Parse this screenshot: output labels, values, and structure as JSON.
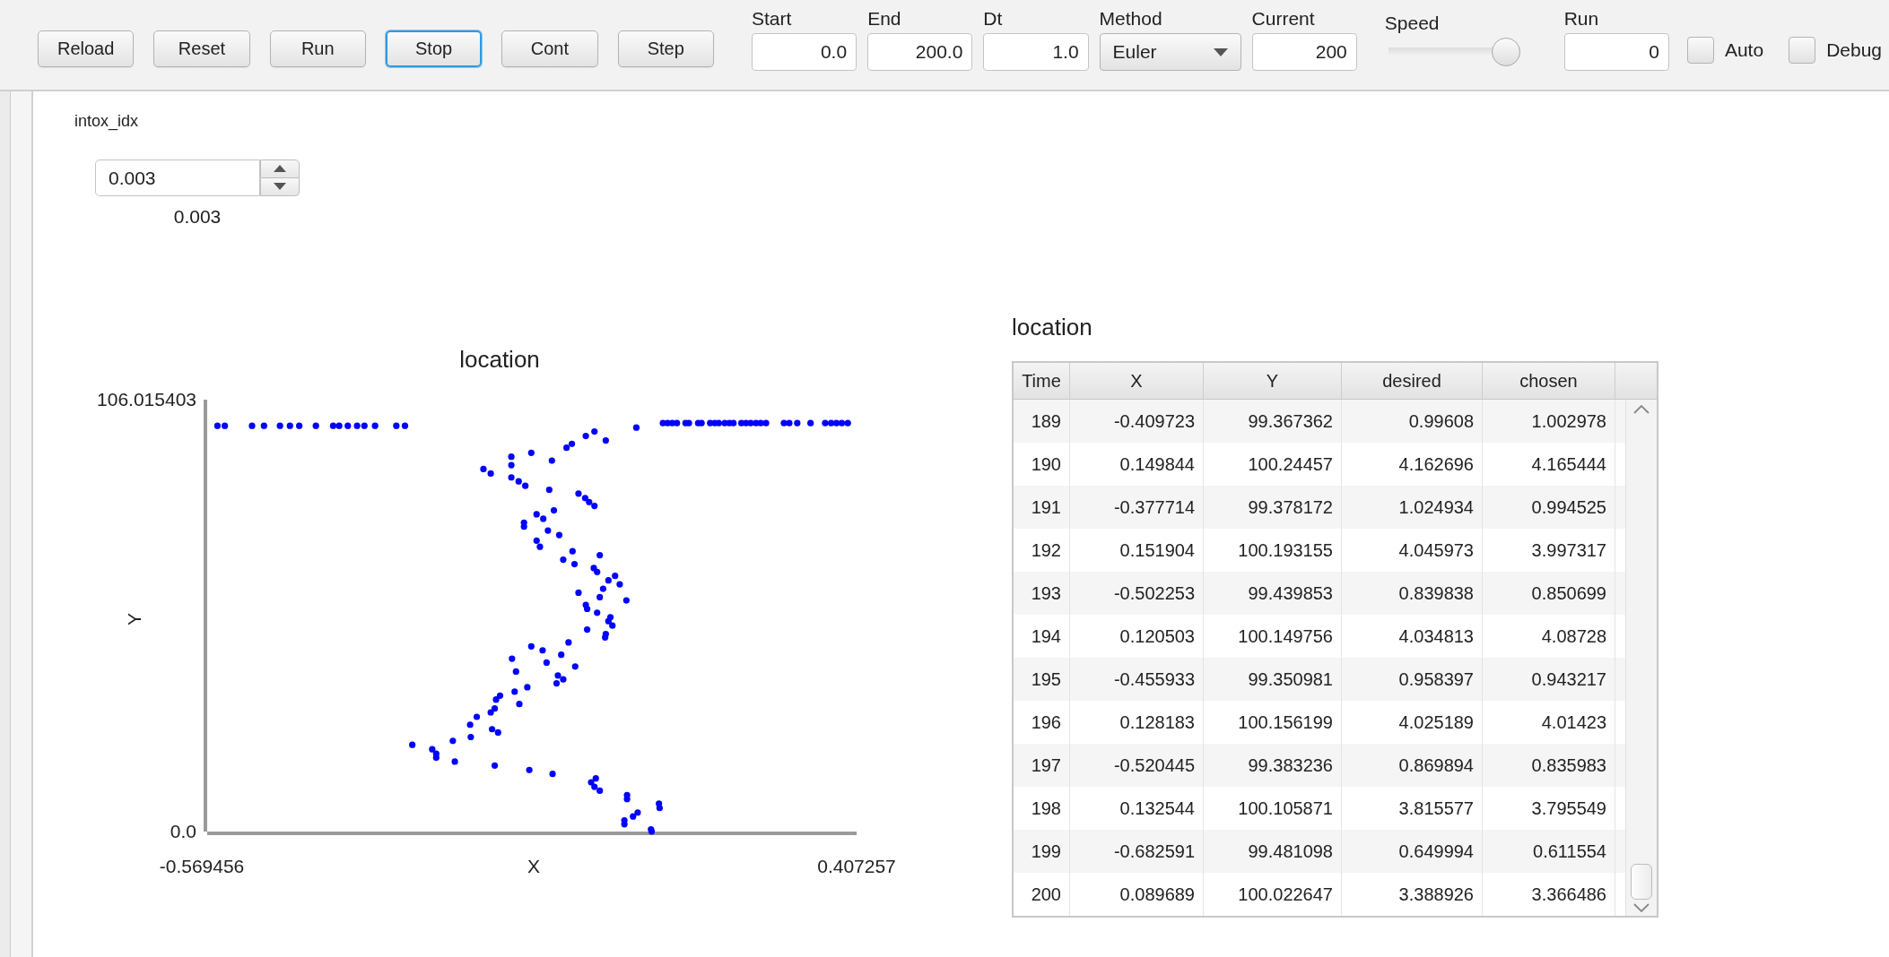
{
  "toolbar": {
    "buttons": [
      {
        "label": "Reload",
        "focused": false
      },
      {
        "label": "Reset",
        "focused": false
      },
      {
        "label": "Run",
        "focused": false
      },
      {
        "label": "Stop",
        "focused": true
      },
      {
        "label": "Cont",
        "focused": false
      },
      {
        "label": "Step",
        "focused": false
      }
    ],
    "fields": [
      {
        "kind": "text",
        "label": "Start",
        "value": "0.0"
      },
      {
        "kind": "text",
        "label": "End",
        "value": "200.0"
      },
      {
        "kind": "text",
        "label": "Dt",
        "value": "1.0"
      },
      {
        "kind": "dropdown",
        "label": "Method",
        "value": "Euler"
      },
      {
        "kind": "text",
        "label": "Current",
        "value": "200"
      },
      {
        "kind": "slider",
        "label": "Speed",
        "level": 1
      },
      {
        "kind": "text",
        "label": "Run",
        "value": "0"
      }
    ],
    "checkboxes": [
      {
        "label": "Auto",
        "checked": false
      },
      {
        "label": "Debug",
        "checked": false
      }
    ]
  },
  "parameter": {
    "label": "intox_idx",
    "value": "0.003",
    "reading": "0.003"
  },
  "chart": {
    "chart_data": {
      "type": "scatter",
      "title": "location",
      "xlabel": "X",
      "ylabel": "Y",
      "xlim": [
        -0.569456,
        0.407257
      ],
      "ylim": [
        0,
        106.015403
      ],
      "xticks": [
        {
          "value": -0.569456,
          "label": "-0.569456"
        },
        {
          "value": 0.407257,
          "label": "0.407257"
        }
      ],
      "yticks": [
        {
          "value": 0,
          "label": "0.0"
        },
        {
          "value": 106.015403,
          "label": "106.015403"
        }
      ],
      "x": [
        -0.554,
        -0.543,
        -0.502,
        -0.484,
        -0.46,
        -0.445,
        -0.431,
        -0.406,
        -0.38,
        -0.371,
        -0.358,
        -0.344,
        -0.333,
        -0.317,
        -0.285,
        -0.272,
        0.116,
        0.123,
        0.13,
        0.137,
        0.15,
        0.155,
        0.169,
        0.174,
        0.187,
        0.194,
        0.2,
        0.209,
        0.216,
        0.222,
        0.234,
        0.241,
        0.248,
        0.256,
        0.263,
        0.271,
        0.298,
        0.306,
        0.318,
        0.338,
        0.36,
        0.369,
        0.377,
        0.385,
        0.394,
        0.076,
        0.013,
        0,
        0.03,
        -0.021,
        -0.029,
        -0.082,
        -0.112,
        -0.051,
        -0.112,
        -0.154,
        -0.143,
        -0.112,
        -0.101,
        -0.091,
        -0.055,
        -0.011,
        -0.001,
        0.005,
        0.013,
        -0.048,
        -0.074,
        -0.064,
        -0.093,
        -0.093,
        -0.057,
        -0.04,
        -0.074,
        -0.069,
        -0.02,
        -0.034,
        -0.017,
        0.021,
        0.012,
        0.017,
        0.044,
        0.034,
        0.051,
        0.026,
        -0.011,
        0.021,
        0.061,
        0,
        0.002,
        0.017,
        0.037,
        0.034,
        0.04,
        0.002,
        0.03,
        0.029,
        -0.026,
        -0.082,
        -0.065,
        -0.037,
        -0.111,
        -0.059,
        -0.016,
        -0.105,
        -0.042,
        -0.034,
        -0.044,
        -0.088,
        -0.107,
        -0.129,
        -0.135,
        -0.1,
        -0.137,
        -0.143,
        -0.164,
        -0.174,
        -0.141,
        -0.132,
        -0.173,
        -0.2,
        -0.261,
        -0.231,
        -0.225,
        -0.225,
        -0.197,
        -0.137,
        -0.085,
        -0.05,
        0.015,
        0.008,
        0.013,
        0.021,
        0.062,
        0.062,
        0.11,
        0.111,
        0.078,
        0.071,
        0.058,
        0.058,
        0.098,
        0.099
      ],
      "series": [
        {
          "color": "#0000ff",
          "values": [
            99.6,
            99.6,
            99.6,
            99.6,
            99.6,
            99.6,
            99.6,
            99.6,
            99.6,
            99.6,
            99.6,
            99.6,
            99.6,
            99.6,
            99.6,
            99.6,
            100.25,
            100.25,
            100.25,
            100.25,
            100.25,
            100.25,
            100.25,
            100.25,
            100.25,
            100.25,
            100.25,
            100.25,
            100.25,
            100.25,
            100.25,
            100.25,
            100.25,
            100.25,
            100.25,
            100.25,
            100.25,
            100.25,
            100.25,
            100.25,
            100.25,
            100.25,
            100.25,
            100.25,
            100.25,
            99.15,
            98.19,
            97.09,
            95.99,
            95.17,
            94.21,
            92.97,
            92.01,
            91.05,
            89.95,
            88.99,
            87.89,
            86.93,
            85.97,
            84.87,
            83.91,
            82.95,
            81.85,
            80.89,
            79.93,
            78.83,
            77.87,
            76.77,
            75.81,
            74.84,
            73.88,
            72.78,
            71.41,
            69.9,
            68.8,
            66.74,
            65.64,
            67.84,
            64.68,
            63.72,
            62.76,
            61.66,
            60.7,
            59.6,
            58.64,
            57.54,
            56.72,
            55.62,
            54.66,
            53.7,
            52.6,
            51.64,
            50.54,
            49.58,
            48.48,
            47.65,
            46.42,
            45.46,
            44.49,
            43.4,
            42.43,
            41.47,
            40.51,
            39.28,
            38.31,
            37.35,
            36.39,
            35.43,
            34.33,
            33.37,
            32.41,
            31.31,
            30.21,
            29.25,
            28.15,
            26.23,
            25.13,
            24.31,
            23.21,
            22.25,
            21.29,
            20.19,
            19.09,
            18.13,
            17.17,
            16.2,
            15.11,
            14.14,
            13.05,
            12.09,
            10.99,
            10.03,
            8.93,
            7.97,
            6.87,
            5.77,
            4.67,
            3.71,
            2.75,
            1.79,
            0.55,
            0
          ]
        }
      ]
    }
  },
  "table": {
    "title": "location",
    "columns": [
      "Time",
      "X",
      "Y",
      "desired",
      "chosen"
    ],
    "rows": [
      [
        "189",
        "-0.409723",
        "99.367362",
        "0.99608",
        "1.002978"
      ],
      [
        "190",
        "0.149844",
        "100.24457",
        "4.162696",
        "4.165444"
      ],
      [
        "191",
        "-0.377714",
        "99.378172",
        "1.024934",
        "0.994525"
      ],
      [
        "192",
        "0.151904",
        "100.193155",
        "4.045973",
        "3.997317"
      ],
      [
        "193",
        "-0.502253",
        "99.439853",
        "0.839838",
        "0.850699"
      ],
      [
        "194",
        "0.120503",
        "100.149756",
        "4.034813",
        "4.08728"
      ],
      [
        "195",
        "-0.455933",
        "99.350981",
        "0.958397",
        "0.943217"
      ],
      [
        "196",
        "0.128183",
        "100.156199",
        "4.025189",
        "4.01423"
      ],
      [
        "197",
        "-0.520445",
        "99.383236",
        "0.869894",
        "0.835983"
      ],
      [
        "198",
        "0.132544",
        "100.105871",
        "3.815577",
        "3.795549"
      ],
      [
        "199",
        "-0.682591",
        "99.481098",
        "0.649994",
        "0.611554"
      ],
      [
        "200",
        "0.089689",
        "100.022647",
        "3.388926",
        "3.366486"
      ]
    ]
  }
}
